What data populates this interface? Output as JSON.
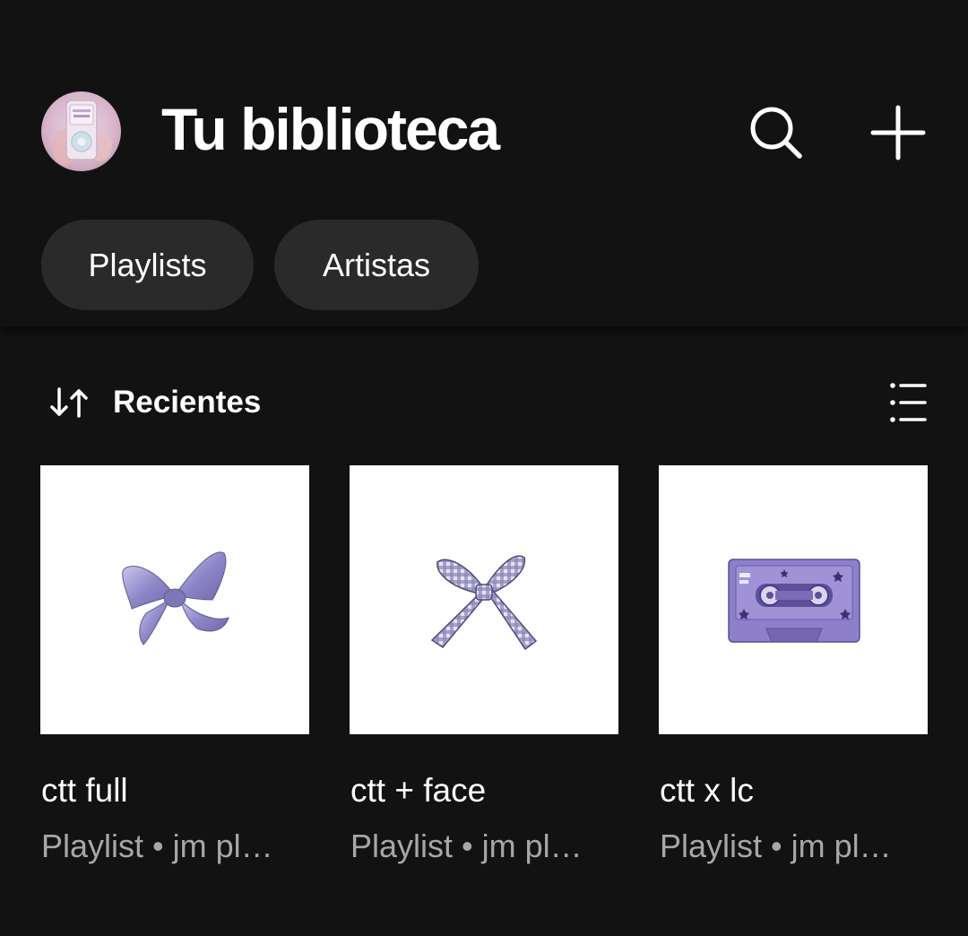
{
  "header": {
    "title": "Tu biblioteca",
    "search_icon": "search-icon",
    "add_icon": "plus-icon",
    "avatar_icon": "profile-avatar"
  },
  "filters": [
    {
      "label": "Playlists"
    },
    {
      "label": "Artistas"
    }
  ],
  "sort": {
    "label": "Recientes",
    "icon": "sort-arrows-icon",
    "view_icon": "list-view-icon"
  },
  "playlists": [
    {
      "title": "ctt full",
      "subtitle": "Playlist • jm pl…",
      "cover": "lavender-satin-bow"
    },
    {
      "title": "ctt + face",
      "subtitle": "Playlist • jm pl…",
      "cover": "gingham-ribbon-bow"
    },
    {
      "title": "ctt x lc",
      "subtitle": "Playlist • jm pl…",
      "cover": "purple-cassette-tape"
    }
  ],
  "colors": {
    "background": "#121212",
    "chip": "#2a2a2a",
    "text_primary": "#ffffff",
    "text_secondary": "#a7a7a7",
    "cover_background": "#ffffff"
  }
}
